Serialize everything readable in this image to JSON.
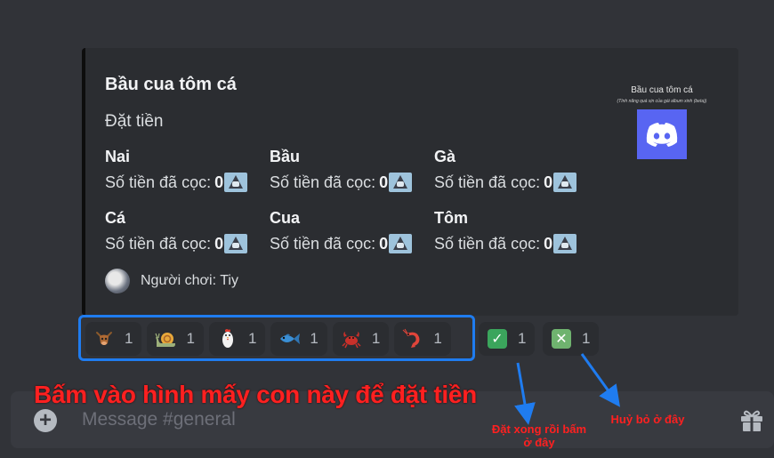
{
  "embed": {
    "title": "Bầu cua tôm cá",
    "description": "Đặt tiền",
    "fields": [
      {
        "name": "Nai",
        "label": "Số tiền đã cọc:",
        "amount": "0"
      },
      {
        "name": "Bầu",
        "label": "Số tiền đã cọc:",
        "amount": "0"
      },
      {
        "name": "Gà",
        "label": "Số tiền đã cọc:",
        "amount": "0"
      },
      {
        "name": "Cá",
        "label": "Số tiền đã cọc:",
        "amount": "0"
      },
      {
        "name": "Cua",
        "label": "Số tiền đã cọc:",
        "amount": "0"
      },
      {
        "name": "Tôm",
        "label": "Số tiền đã cọc:",
        "amount": "0"
      }
    ],
    "footer": {
      "text": "Người chơi: Tiy"
    },
    "thumbnail": {
      "title": "Bầu cua tôm cá",
      "subtitle": "(Tính năng quá xịn của gái album xinh (beta))"
    }
  },
  "reactions": [
    {
      "icon": "deer-icon",
      "emoji": "🐂",
      "count": "1"
    },
    {
      "icon": "snail-icon",
      "emoji": "🐌",
      "count": "1"
    },
    {
      "icon": "rooster-icon",
      "emoji": "🐓",
      "count": "1"
    },
    {
      "icon": "fish-icon",
      "emoji": "🐟",
      "count": "1"
    },
    {
      "icon": "crab-icon",
      "emoji": "🦀",
      "count": "1"
    },
    {
      "icon": "shrimp-icon",
      "emoji": "🦐",
      "count": "1"
    }
  ],
  "confirm": {
    "icon": "check-icon",
    "glyph": "✓",
    "count": "1"
  },
  "cancel": {
    "icon": "cross-icon",
    "glyph": "✕",
    "count": "1"
  },
  "input": {
    "placeholder": "Message #general"
  },
  "annotations": {
    "main": "Bấm vào hình mấy con này để đặt tiền",
    "done_line1": "Đặt xong rồi bấm",
    "done_line2": "ở đây",
    "cancel": "Huỷ bỏ ở đây"
  },
  "colors": {
    "accent": "#5865f2",
    "annotation": "#ff2020",
    "highlight": "#1f7cf0"
  }
}
